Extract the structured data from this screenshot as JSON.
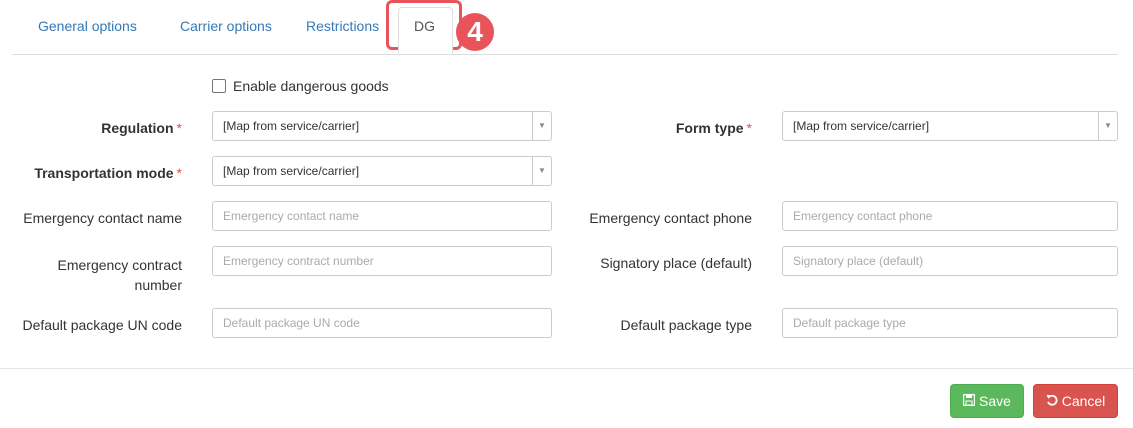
{
  "tabs": {
    "general": "General options",
    "carrier": "Carrier options",
    "restrictions": "Restrictions",
    "dg": "DG",
    "step_badge": "4"
  },
  "enable_dg": {
    "label": "Enable dangerous goods",
    "checked": false
  },
  "fields": {
    "regulation": {
      "label": "Regulation",
      "value": "[Map from service/carrier]"
    },
    "form_type": {
      "label": "Form type",
      "value": "[Map from service/carrier]"
    },
    "transport_mode": {
      "label": "Transportation mode",
      "value": "[Map from service/carrier]"
    },
    "emergency_name": {
      "label": "Emergency contact name",
      "placeholder": "Emergency contact name"
    },
    "emergency_phone": {
      "label": "Emergency contact phone",
      "placeholder": "Emergency contact phone"
    },
    "emergency_contract_line1": "Emergency contract",
    "emergency_contract_line2": "number",
    "emergency_contract_placeholder": "Emergency contract number",
    "signatory": {
      "label": "Signatory place (default)",
      "placeholder": "Signatory place (default)"
    },
    "un_code": {
      "label": "Default package UN code",
      "placeholder": "Default package UN code"
    },
    "package_type": {
      "label": "Default package type",
      "placeholder": "Default package type"
    }
  },
  "required_marker": "*",
  "buttons": {
    "save": "Save",
    "cancel": "Cancel"
  },
  "icons": {
    "save": "floppy-icon",
    "cancel": "undo-icon",
    "dropdown": "caret-down-icon"
  }
}
